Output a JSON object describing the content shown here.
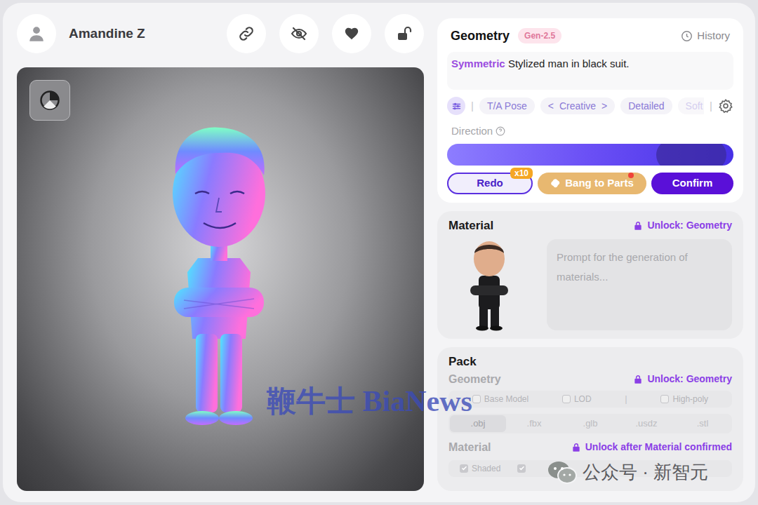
{
  "user": {
    "name": "Amandine Z"
  },
  "geometry": {
    "title": "Geometry",
    "badge": "Gen-2.5",
    "history": "History",
    "prompt": {
      "keyword": "Symmetric",
      "text": "Stylized man in black suit."
    },
    "separator": "|",
    "chips": [
      {
        "label": "T/A Pose",
        "kind": "plain"
      },
      {
        "label": "Creative",
        "kind": "stepper",
        "prev": "<",
        "next": ">"
      },
      {
        "label": "Detailed",
        "kind": "plain"
      },
      {
        "label": "Soft",
        "kind": "faded"
      }
    ],
    "direction": {
      "label": "Direction"
    },
    "actions": {
      "redo": {
        "label": "Redo",
        "badge": "x10"
      },
      "bang": {
        "label": "Bang to Parts",
        "notify": true
      },
      "confirm": {
        "label": "Confirm"
      }
    }
  },
  "material": {
    "title": "Material",
    "lock": "Unlock: Geometry",
    "placeholder": "Prompt for the generation of materials..."
  },
  "pack": {
    "title": "Pack",
    "geometry": {
      "label": "Geometry",
      "lock": "Unlock: Geometry",
      "separator": "|",
      "options": [
        {
          "label": "Base Model",
          "checked": false
        },
        {
          "label": "LOD",
          "checked": false
        },
        {
          "label": "High-poly",
          "checked": false
        }
      ],
      "formats": [
        {
          "label": ".obj",
          "selected": true
        },
        {
          "label": ".fbx",
          "selected": false
        },
        {
          "label": ".glb",
          "selected": false
        },
        {
          "label": ".usdz",
          "selected": false
        },
        {
          "label": ".stl",
          "selected": false
        }
      ]
    },
    "material": {
      "label": "Material",
      "lock": "Unlock after Material confirmed",
      "options": [
        {
          "label": "Shaded",
          "checked": true
        },
        {
          "checked": true
        }
      ]
    }
  },
  "watermarks": {
    "bianews": "鞭牛士 BiaNews",
    "wechat": "公众号 · 新智元"
  }
}
